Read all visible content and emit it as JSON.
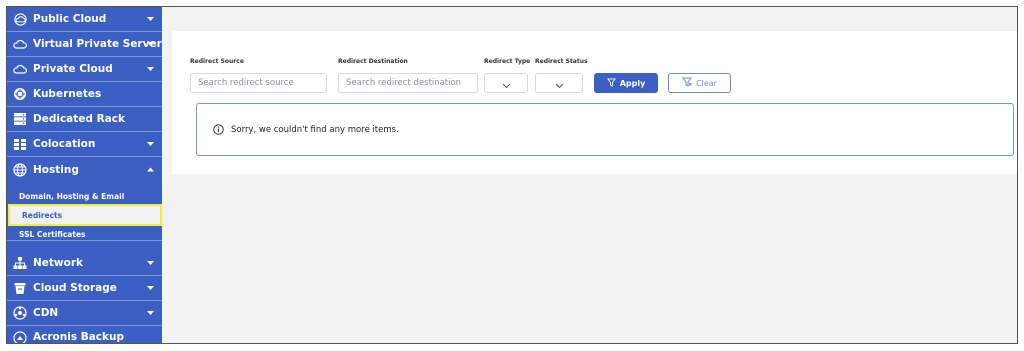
{
  "sidebar": {
    "items": [
      {
        "label": "Public Cloud",
        "icon": "cloud-outline-icon",
        "expandable": true,
        "expanded": false
      },
      {
        "label": "Virtual Private Server",
        "icon": "cloud-icon",
        "expandable": true,
        "expanded": false
      },
      {
        "label": "Private Cloud",
        "icon": "cloud-icon",
        "expandable": true,
        "expanded": false
      },
      {
        "label": "Kubernetes",
        "icon": "kubernetes-icon",
        "expandable": false
      },
      {
        "label": "Dedicated Rack",
        "icon": "server-rack-icon",
        "expandable": false
      },
      {
        "label": "Colocation",
        "icon": "colocation-icon",
        "expandable": true,
        "expanded": false
      },
      {
        "label": "Hosting",
        "icon": "globe-icon",
        "expandable": true,
        "expanded": true
      },
      {
        "label": "Network",
        "icon": "network-icon",
        "expandable": true,
        "expanded": false
      },
      {
        "label": "Cloud Storage",
        "icon": "storage-icon",
        "expandable": true,
        "expanded": false
      },
      {
        "label": "CDN",
        "icon": "cdn-icon",
        "expandable": true,
        "expanded": false
      },
      {
        "label": "Acronis Backup",
        "icon": "backup-icon",
        "expandable": false
      }
    ],
    "hosting_sub": [
      {
        "label": "Domain, Hosting & Email"
      },
      {
        "label": "Redirects",
        "active": true
      },
      {
        "label": "SSL Certificates"
      }
    ]
  },
  "filters": {
    "source_label": "Redirect Source",
    "source_placeholder": "Search redirect source",
    "destination_label": "Redirect Destination",
    "destination_placeholder": "Search redirect destination",
    "type_label": "Redirect Type",
    "status_label": "Redirect Status",
    "apply_label": "Apply",
    "clear_label": "Clear"
  },
  "notice": {
    "message": "Sorry, we couldn't find any more items."
  },
  "colors": {
    "sidebar_bg": "#3c5fc4",
    "accent": "#3c5fc4",
    "highlight": "#f0f034"
  }
}
